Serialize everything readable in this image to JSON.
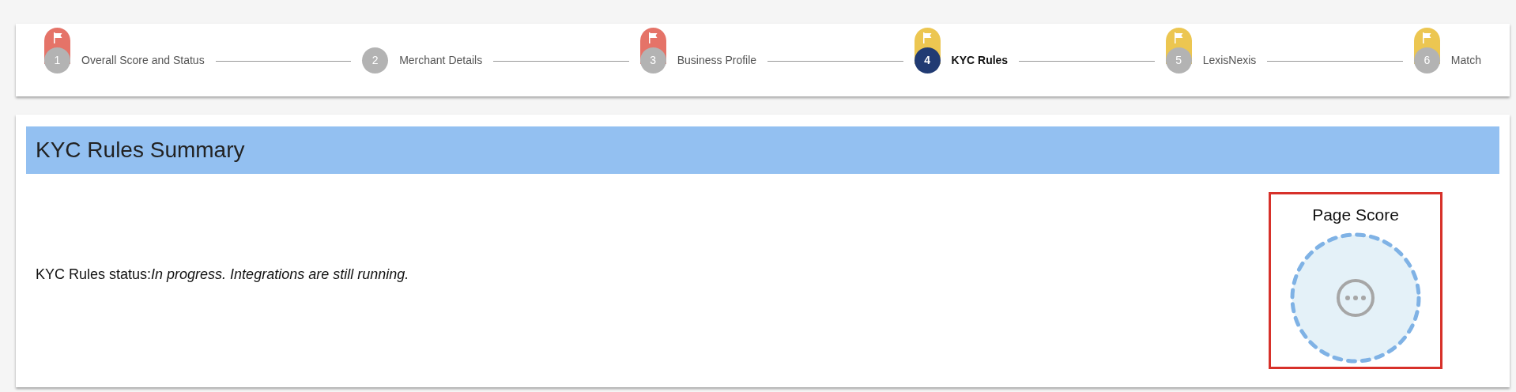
{
  "stepper": {
    "steps": [
      {
        "number": "1",
        "label": "Overall Score and Status",
        "selected": false,
        "color": "#e57368"
      },
      {
        "number": "2",
        "label": "Merchant Details",
        "selected": false
      },
      {
        "number": "3",
        "label": "Business Profile",
        "selected": false,
        "color": "#e57368"
      },
      {
        "number": "4",
        "label": "KYC Rules",
        "selected": true,
        "color": "#ecc651"
      },
      {
        "number": "5",
        "label": "LexisNexis",
        "selected": false,
        "color": "#ecc651"
      },
      {
        "number": "6",
        "label": "Match",
        "selected": false,
        "color": "#ecc651"
      }
    ]
  },
  "summary": {
    "title": "KYC Rules Summary",
    "status_label": "KYC Rules status:",
    "status_value": "In progress. Integrations are still running.",
    "score_title": "Page Score"
  }
}
